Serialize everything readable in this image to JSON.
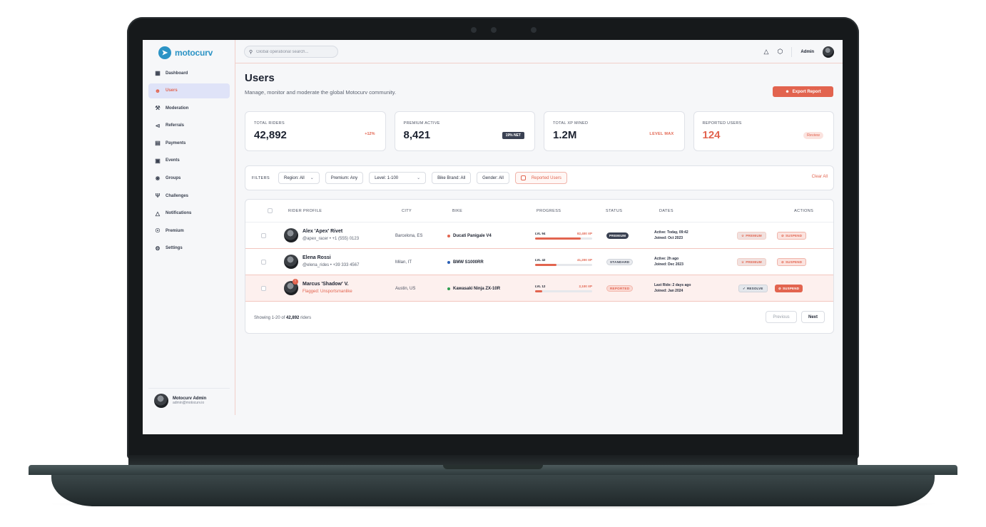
{
  "app": {
    "brand": "motocurv"
  },
  "sidebar": {
    "items": [
      {
        "label": "Dashboard",
        "icon": "dashboard-grid-icon"
      },
      {
        "label": "Users",
        "icon": "users-icon"
      },
      {
        "label": "Moderation",
        "icon": "gavel-icon"
      },
      {
        "label": "Referrals",
        "icon": "share-icon"
      },
      {
        "label": "Payments",
        "icon": "payments-icon"
      },
      {
        "label": "Events",
        "icon": "calendar-icon"
      },
      {
        "label": "Groups",
        "icon": "groups-network-icon"
      },
      {
        "label": "Challenges",
        "icon": "trophy-icon"
      },
      {
        "label": "Notifications",
        "icon": "bell-icon"
      },
      {
        "label": "Premium",
        "icon": "badge-icon"
      },
      {
        "label": "Settings",
        "icon": "gear-icon"
      }
    ],
    "active": "Users",
    "profile": {
      "name": "Motocurv Admin",
      "email": "admin@motocurv.io"
    }
  },
  "topbar": {
    "search_placeholder": "Global operational search...",
    "admin_label": "Admin"
  },
  "header": {
    "title": "Users",
    "subtitle": "Manage, monitor and moderate the global Motocurv community.",
    "export_label": "Export Report"
  },
  "stats": [
    {
      "label": "TOTAL RIDERS",
      "value": "42,892",
      "tag": "+12%"
    },
    {
      "label": "PREMIUM ACTIVE",
      "value": "8,421",
      "tag": "19% NET"
    },
    {
      "label": "TOTAL XP MINED",
      "value": "1.2M",
      "tag": "LEVEL MAX"
    },
    {
      "label": "REPORTED USERS",
      "value": "124",
      "tag": "Review"
    }
  ],
  "filters": {
    "label": "FILTERS",
    "chips": [
      "Region: All",
      "Premium: Any",
      "Level: 1-100",
      "Bike Brand: All",
      "Gender: All"
    ],
    "reported_label": "Reported Users",
    "clear_label": "Clear All"
  },
  "table": {
    "headers": [
      "RIDER PROFILE",
      "CITY",
      "BIKE",
      "PROGRESS",
      "STATUS",
      "DATES",
      "ACTIONS"
    ],
    "rows": [
      {
        "name": "Alex 'Apex' Rivet",
        "handle": "@apex_racer • +1 (555) 0123",
        "city": "Barcelona, ES",
        "bike": "Ducati Panigale V4",
        "bike_color": "#e2644f",
        "level": "LVL 94",
        "xp": "82,400 XP",
        "progress": 0.8,
        "status": "PREMIUM",
        "date1": "Active: Today, 09:42",
        "date2": "Joined: Oct 2023",
        "action1": "PREMIUM",
        "action2": "SUSPEND"
      },
      {
        "name": "Elena Rossi",
        "handle": "@elena_rides • +39 333 4567",
        "city": "Milan, IT",
        "bike": "BMW S1000RR",
        "bike_color": "#2b5fb5",
        "level": "LVL 42",
        "xp": "41,200 XP",
        "progress": 0.37,
        "status": "STANDARD",
        "date1": "Active: 2h ago",
        "date2": "Joined: Dec 2023",
        "action1": "PREMIUM",
        "action2": "SUSPEND"
      },
      {
        "name": "Marcus 'Shadow' V.",
        "handle": "Flagged: Unsportsmanlike",
        "city": "Austin, US",
        "bike": "Kawasaki Ninja ZX-10R",
        "bike_color": "#2e9e4f",
        "level": "LVL 12",
        "xp": "2,100 XP",
        "progress": 0.12,
        "status": "REPORTED",
        "date1": "Last Ride: 2 days ago",
        "date2": "Joined: Jan 2024",
        "action1": "RESOLVE",
        "action2": "SUSPEND",
        "badge": "!"
      }
    ]
  },
  "pagination": {
    "showing_prefix": "Showing 1-20 of",
    "total": "42,892",
    "showing_suffix": "riders",
    "prev_label": "Previous",
    "next_label": "Next"
  }
}
